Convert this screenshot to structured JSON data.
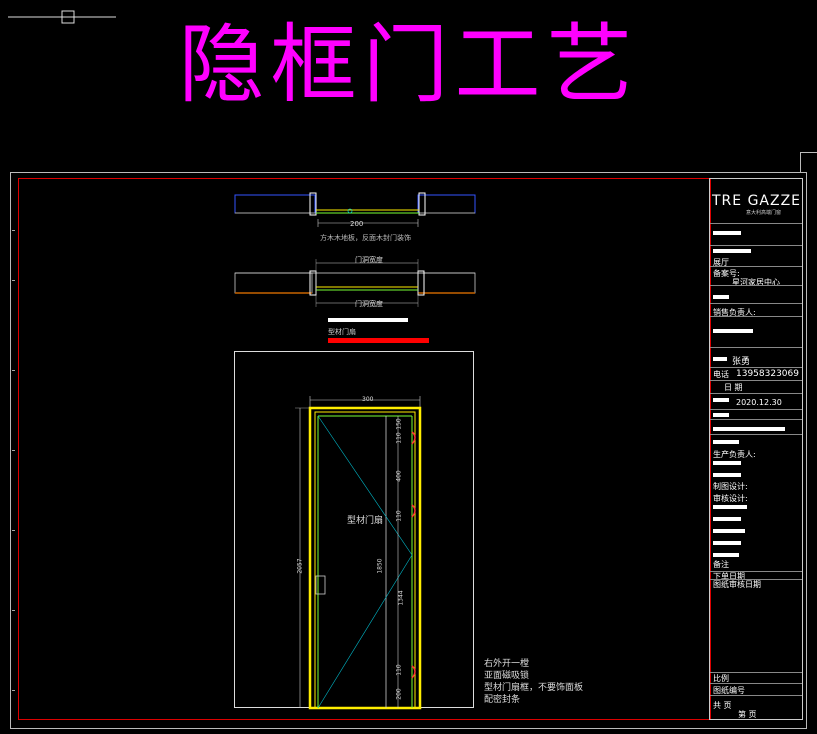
{
  "title": "隐框门工艺",
  "plan_top": {
    "dim_label": "200",
    "caption": "方木木地板，反面木封门装饰"
  },
  "plan_mid": {
    "top_dim": "门洞宽度",
    "bottom_dim": "门洞宽度",
    "legend_text": "型材门扇"
  },
  "elevation": {
    "width_dim": "300",
    "height_dim_outer": "2057",
    "height_dim_inner": "1850",
    "leaf_label": "型材门扇",
    "hinge_dims": [
      "110",
      "150",
      "400",
      "110",
      "1344",
      "110",
      "200"
    ],
    "notes": [
      "右外开一樘",
      "亚面磁吸锁",
      "型材门扇框，不要饰面板",
      "配密封条"
    ]
  },
  "title_block": {
    "logo": "TRE GAZZE",
    "logo_sub": "意大利高端门窗",
    "rows": [
      {
        "label": "",
        "value": ""
      },
      {
        "label": "展厅",
        "value": ""
      },
      {
        "label": "备案号:",
        "value": "星河家居中心"
      },
      {
        "label": "",
        "value": ""
      },
      {
        "label": "销售负责人:",
        "value": ""
      },
      {
        "label": "",
        "value": ""
      },
      {
        "label": "",
        "value": "张勇"
      },
      {
        "label": "电话",
        "value": "13958323069"
      },
      {
        "label": "日 期",
        "value": ""
      },
      {
        "label": "",
        "value": "2020.12.30"
      },
      {
        "label": "生产负责人:",
        "value": ""
      },
      {
        "label": "制图设计:",
        "value": ""
      },
      {
        "label": "审核设计:",
        "value": ""
      },
      {
        "label": "备注",
        "value": ""
      },
      {
        "label": "下单日期",
        "value": ""
      },
      {
        "label": "图纸审核日期",
        "value": ""
      },
      {
        "label": "比例",
        "value": ""
      },
      {
        "label": "图纸编号",
        "value": ""
      },
      {
        "label": "共 页",
        "value": "第 页"
      }
    ]
  }
}
